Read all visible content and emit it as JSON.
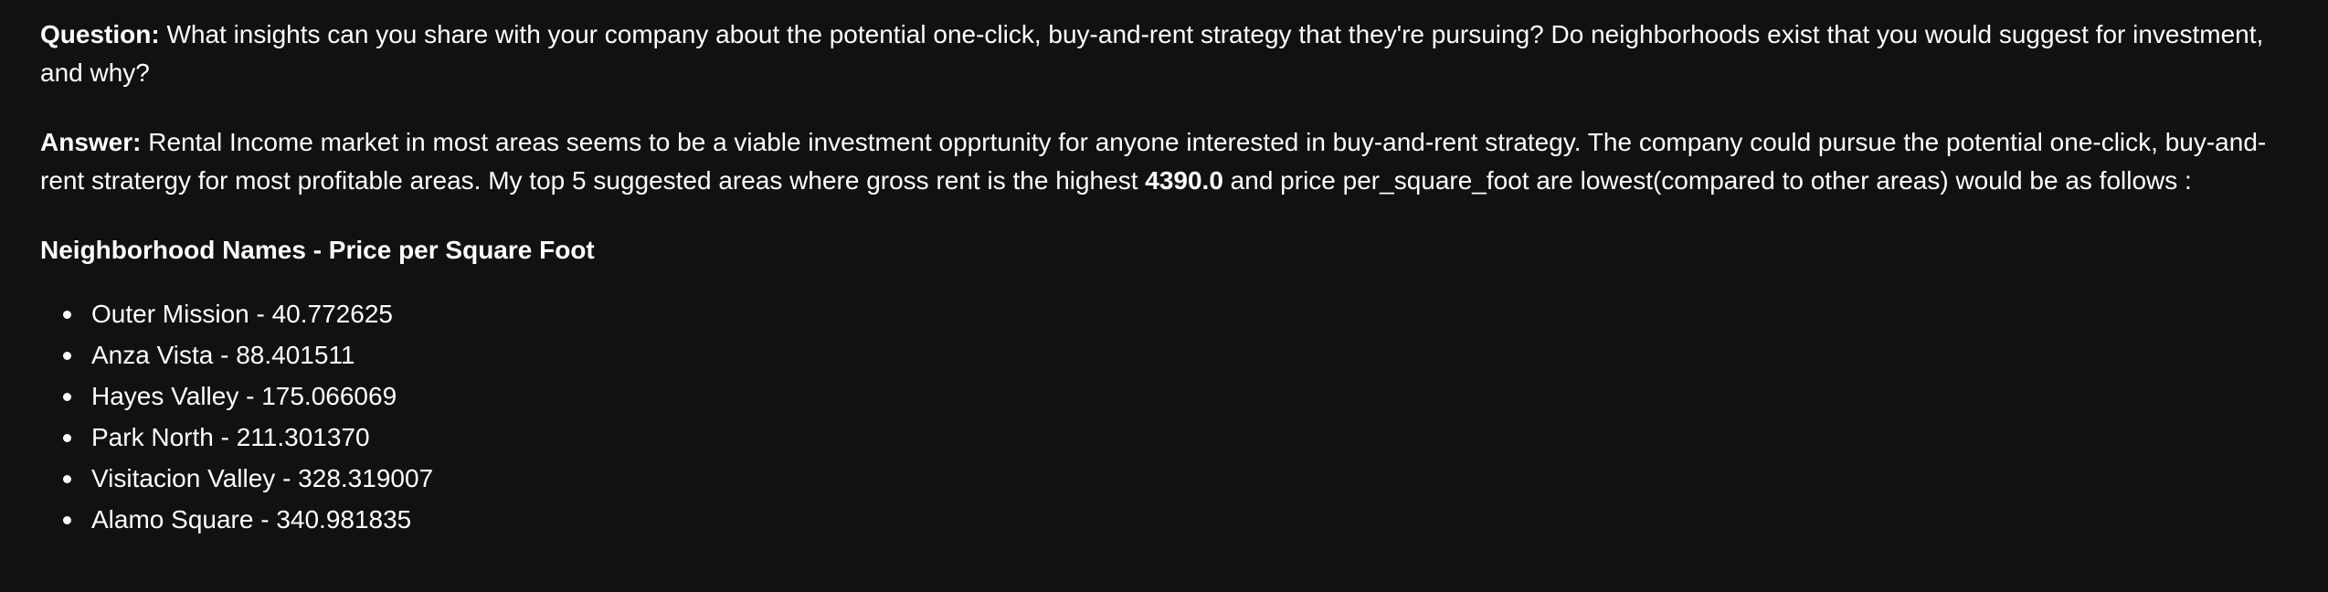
{
  "question": {
    "label": "Question:",
    "text": " What insights can you share with your company about the potential one-click, buy-and-rent strategy that they're pursuing? Do neighborhoods exist that you would suggest for investment, and why?"
  },
  "answer": {
    "label": "Answer:",
    "text_before": " Rental Income market in most areas seems to be a viable investment opprtunity for anyone interested in buy-and-rent strategy. The company could pursue the potential one-click, buy-and-rent stratergy for most profitable areas. My top 5 suggested areas where gross rent is the highest ",
    "highlight": "4390.0",
    "text_after": " and price per_square_foot are lowest(compared to other areas) would be as follows :"
  },
  "list_heading": "Neighborhood Names - Price per Square Foot",
  "neighborhoods": [
    "Outer Mission - 40.772625",
    "Anza Vista - 88.401511",
    "Hayes Valley - 175.066069",
    "Park North - 211.301370",
    "Visitacion Valley - 328.319007",
    "Alamo Square - 340.981835"
  ]
}
